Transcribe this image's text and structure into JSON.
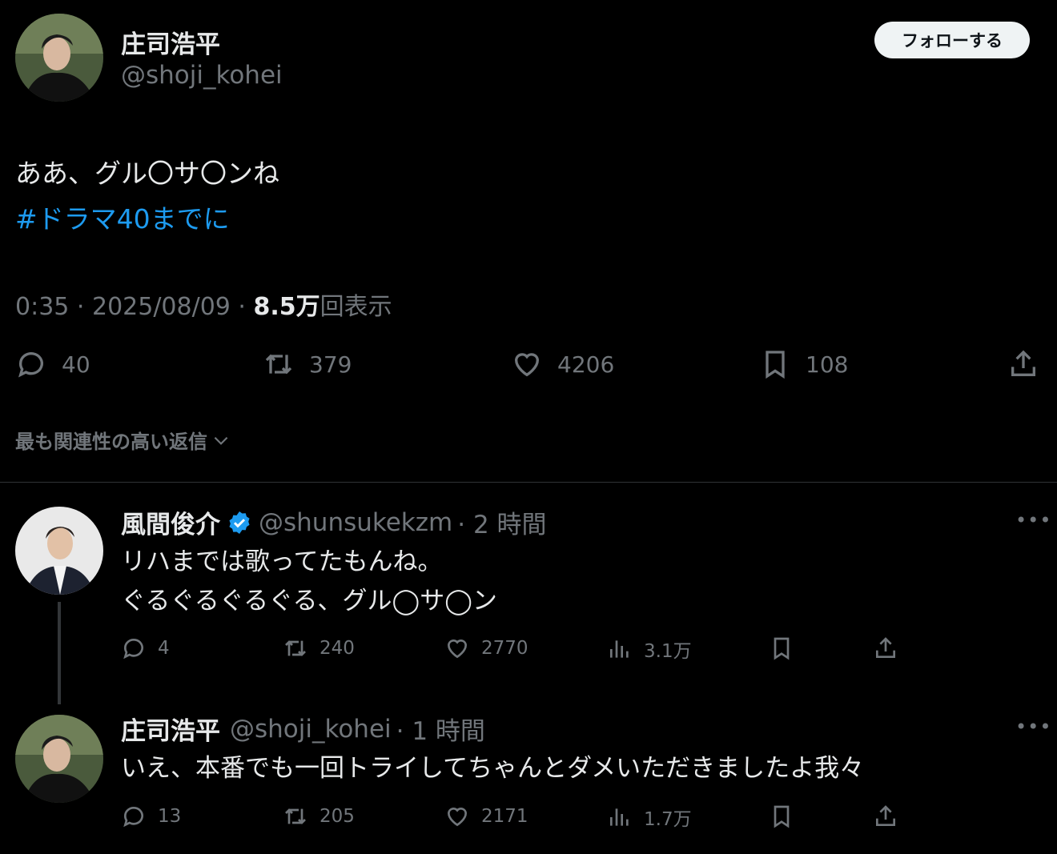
{
  "main_tweet": {
    "display_name": "庄司浩平",
    "handle": "@shoji_kohei",
    "follow_label": "フォローする",
    "text_line1": "ああ、グル〇サ〇ンね",
    "hashtag": "#ドラマ40までに",
    "time": "0:35 · 2025/08/09 · ",
    "views_count": "8.5万",
    "views_label": "回表示",
    "actions": {
      "reply": "40",
      "retweet": "379",
      "like": "4206",
      "bookmark": "108"
    }
  },
  "replies_sort": {
    "label": "最も関連性の高い返信"
  },
  "replies": [
    {
      "display_name": "風間俊介",
      "verified": true,
      "handle": "@shunsukekzm",
      "time": "· 2 時間",
      "line1": "リハまでは歌ってたもんね。",
      "line2": "ぐるぐるぐるぐる、グル◯サ◯ン",
      "actions": {
        "reply": "4",
        "retweet": "240",
        "like": "2770",
        "views": "3.1万"
      }
    },
    {
      "display_name": "庄司浩平",
      "handle": "@shoji_kohei",
      "time": "· 1 時間",
      "line1": "いえ、本番でも一回トライしてちゃんとダメいただきましたよ我々",
      "actions": {
        "reply": "13",
        "retweet": "205",
        "like": "2171",
        "views": "1.7万"
      }
    }
  ],
  "colors": {
    "accent": "#1d9bf0",
    "text": "#e7e9ea",
    "muted": "#71767b",
    "bg": "#000000"
  },
  "icons": [
    "reply-icon",
    "retweet-icon",
    "like-icon",
    "bookmark-icon",
    "share-icon",
    "views-icon",
    "verified-icon",
    "chevron-down-icon",
    "more-icon"
  ]
}
